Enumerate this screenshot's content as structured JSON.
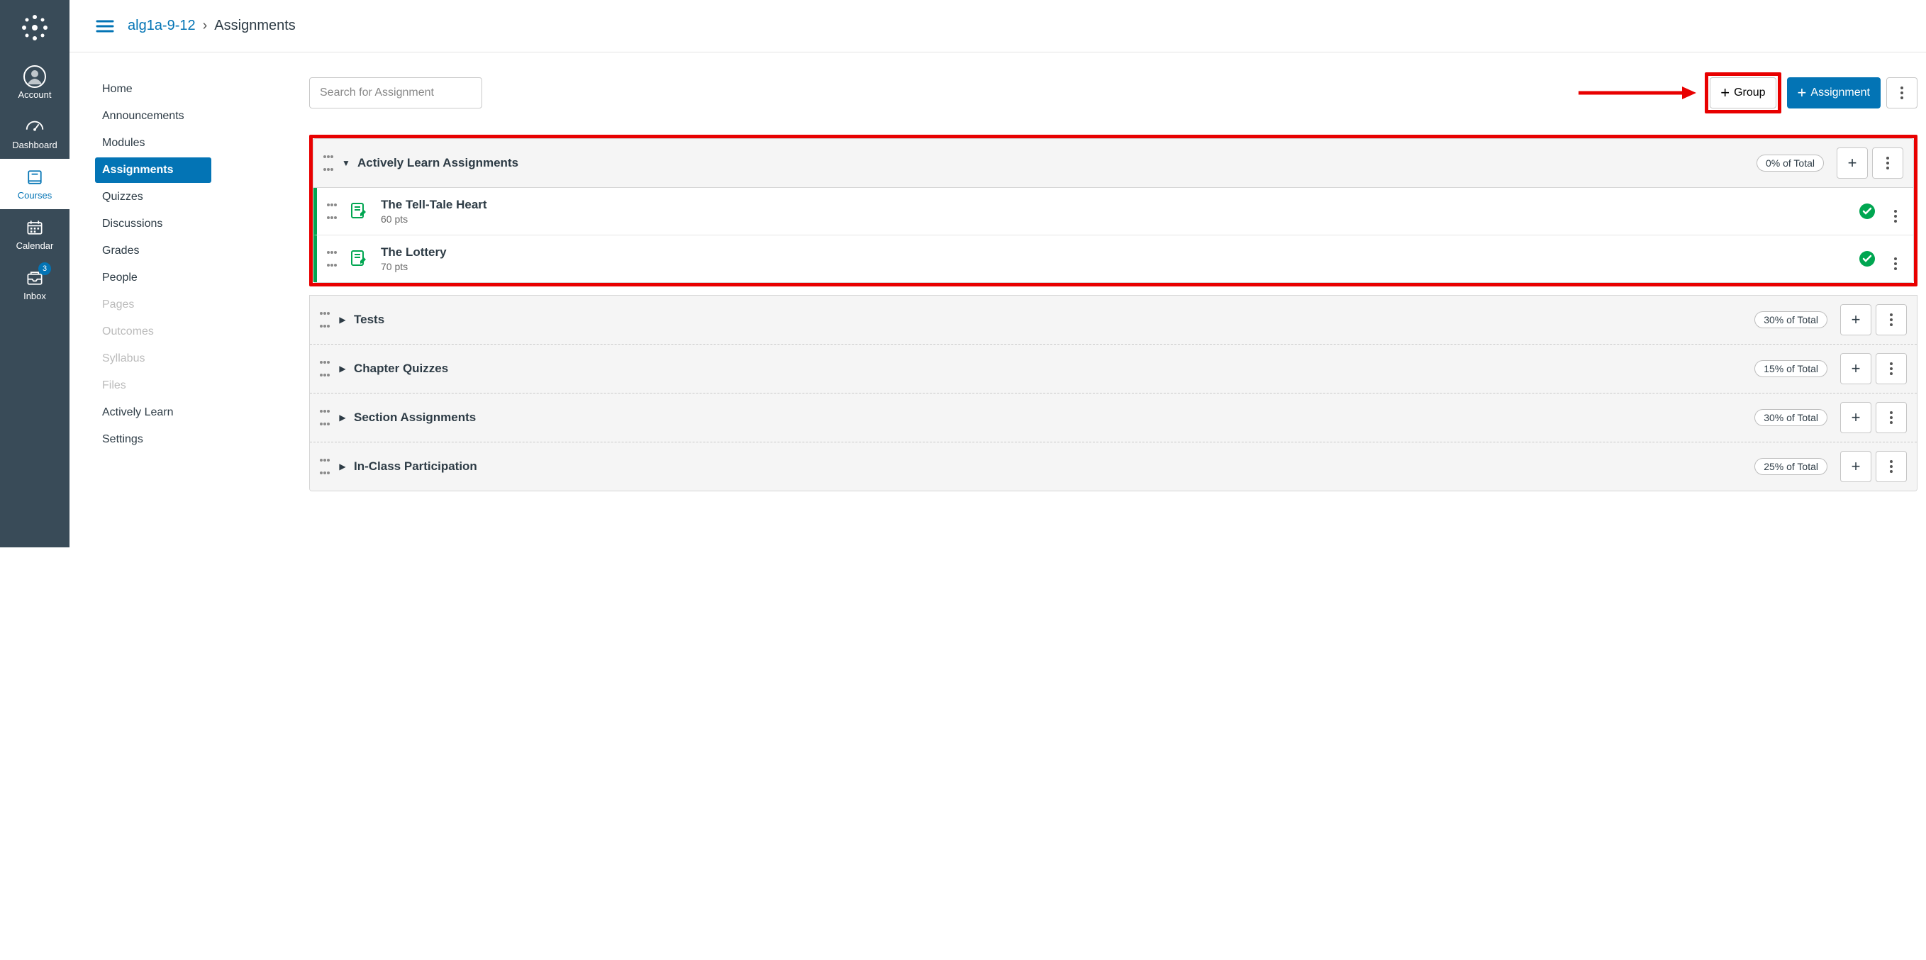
{
  "global_nav": {
    "items": [
      {
        "label": "Account"
      },
      {
        "label": "Dashboard"
      },
      {
        "label": "Courses"
      },
      {
        "label": "Calendar"
      },
      {
        "label": "Inbox",
        "badge": "3"
      }
    ]
  },
  "breadcrumb": {
    "course": "alg1a-9-12",
    "current": "Assignments"
  },
  "course_nav": {
    "items": [
      "Home",
      "Announcements",
      "Modules",
      "Assignments",
      "Quizzes",
      "Discussions",
      "Grades",
      "People",
      "Pages",
      "Outcomes",
      "Syllabus",
      "Files",
      "Actively Learn",
      "Settings"
    ],
    "active_index": 3,
    "disabled_indices": [
      8,
      9,
      10,
      11
    ]
  },
  "toolbar": {
    "search_placeholder": "Search for Assignment",
    "group_label": "Group",
    "assignment_label": "Assignment"
  },
  "groups": [
    {
      "title": "Actively Learn Assignments",
      "pct": "0% of Total",
      "expanded": true,
      "items": [
        {
          "title": "The Tell-Tale Heart",
          "pts": "60 pts",
          "published": true
        },
        {
          "title": "The Lottery",
          "pts": "70 pts",
          "published": true
        }
      ]
    },
    {
      "title": "Tests",
      "pct": "30% of Total",
      "expanded": false
    },
    {
      "title": "Chapter Quizzes",
      "pct": "15% of Total",
      "expanded": false
    },
    {
      "title": "Section Assignments",
      "pct": "30% of Total",
      "expanded": false
    },
    {
      "title": "In-Class Participation",
      "pct": "25% of Total",
      "expanded": false
    }
  ]
}
